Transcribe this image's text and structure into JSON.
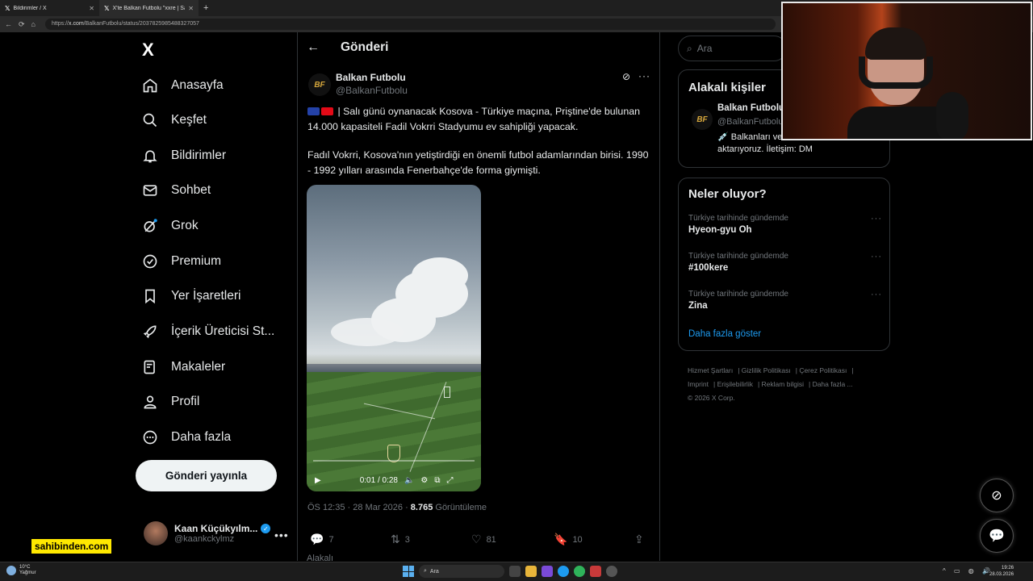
{
  "browser": {
    "tabs": [
      {
        "label": "Bildirimler / X",
        "active": false
      },
      {
        "label": "X'te Balkan Futbolu \"xxre | Salı gü",
        "active": true
      }
    ],
    "url_prefix": "https://",
    "url_host": "x.com",
    "url_path": "/BalkanFutbolu/status/2037825985488327057"
  },
  "nav": {
    "logo": "X",
    "items": [
      {
        "label": "Anasayfa",
        "icon": "home-icon"
      },
      {
        "label": "Keşfet",
        "icon": "search-icon"
      },
      {
        "label": "Bildirimler",
        "icon": "bell-icon"
      },
      {
        "label": "Sohbet",
        "icon": "mail-icon"
      },
      {
        "label": "Grok",
        "icon": "grok-icon"
      },
      {
        "label": "Premium",
        "icon": "premium-icon"
      },
      {
        "label": "Yer İşaretleri",
        "icon": "bookmark-icon"
      },
      {
        "label": "İçerik Üreticisi St...",
        "icon": "rocket-icon"
      },
      {
        "label": "Makaleler",
        "icon": "article-icon"
      },
      {
        "label": "Profil",
        "icon": "person-icon"
      },
      {
        "label": "Daha fazla",
        "icon": "more-circle-icon"
      }
    ],
    "post_button": "Gönderi yayınla",
    "account": {
      "name": "Kaan Küçükyılm...",
      "handle": "@kaankckylmz"
    }
  },
  "overlay_brand": "sahibinden.com",
  "main": {
    "title": "Gönderi",
    "tweet": {
      "author": "Balkan Futbolu",
      "handle": "@BalkanFutbolu",
      "avatar_text": "BF",
      "paragraph1": "| Salı günü oynanacak Kosova - Türkiye maçına, Priştine'de bulunan 14.000 kapasiteli Fadil Vokrri Stadyumu ev sahipliği yapacak.",
      "paragraph2": "Fadıl Vokrri, Kosova'nın yetiştirdiği en önemli futbol adamlarından birisi. 1990 - 1992 yılları arasında Fenerbahçe'de forma giymişti.",
      "video_time": "0:01 / 0:28",
      "timestamp": "ÖS 12:35 · 28 Mar 2026 · ",
      "views": "8.765",
      "views_label": " Görüntüleme",
      "replies": "7",
      "reposts": "3",
      "likes": "81",
      "bookmarks": "10"
    },
    "related_label": "Alakalı"
  },
  "sidebar": {
    "search_placeholder": "Ara",
    "related_title": "Alakalı kişiler",
    "related_person": {
      "name": "Balkan Futbolu",
      "handle": "@BalkanFutbolu",
      "bio": "💉 Balkanları ve Balkan futbolunu aktarıyoruz. İletişim: DM"
    },
    "trends_title": "Neler oluyor?",
    "trends": [
      {
        "context": "Türkiye tarihinde gündemde",
        "title": "Hyeon-gyu Oh"
      },
      {
        "context": "Türkiye tarihinde gündemde",
        "title": "#100kere"
      },
      {
        "context": "Türkiye tarihinde gündemde",
        "title": "Zina"
      }
    ],
    "show_more": "Daha fazla göster",
    "footer": [
      "Hizmet Şartları",
      "Gizlilik Politikası",
      "Çerez Politikası",
      "Imprint",
      "Erişilebilirlik",
      "Reklam bilgisi",
      "Daha fazla ...",
      "© 2026 X Corp."
    ]
  },
  "taskbar": {
    "weather_temp": "10°C",
    "weather_desc": "Yağmur",
    "search_label": "Ara",
    "time": "19:26",
    "date": "28.03.2026"
  },
  "colors": {
    "accent": "#1d9bf0",
    "background": "#000000",
    "post_button": "#eff3f4",
    "sahibinden": "#ffe800"
  }
}
